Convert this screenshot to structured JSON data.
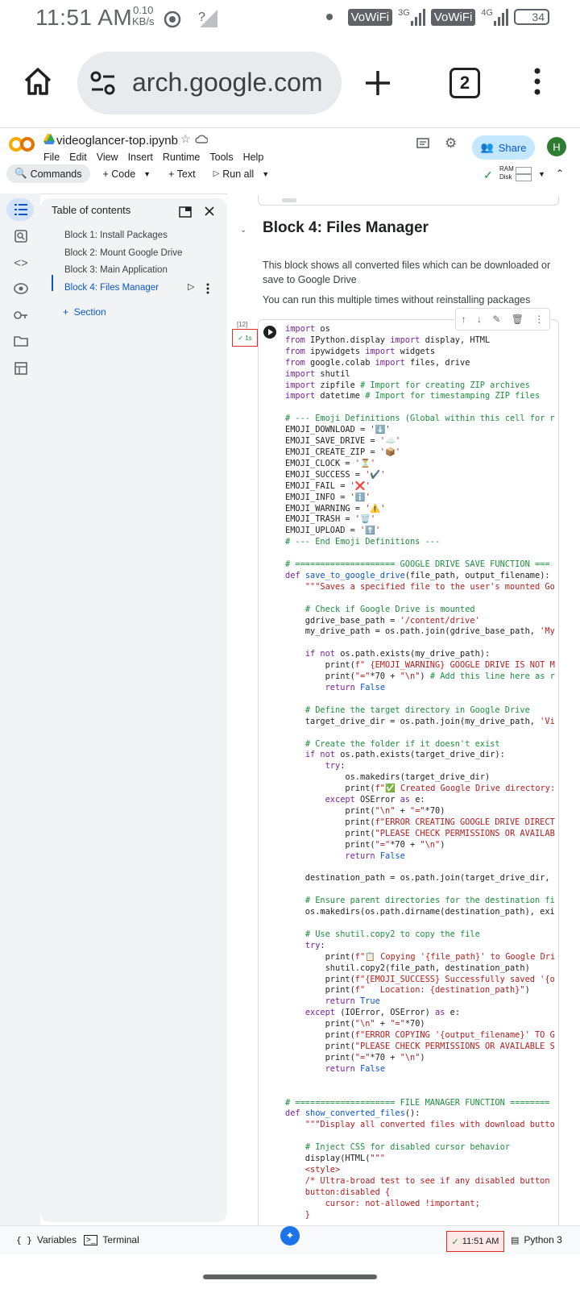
{
  "status": {
    "time": "11:51 AM",
    "speed_value": "0.10",
    "speed_unit": "KB/s",
    "wifi1": "VoWiFi",
    "net1": "3G",
    "wifi2": "VoWiFi",
    "net2": "4G",
    "battery": "34"
  },
  "browser": {
    "url": "arch.google.com",
    "tab_count": "2"
  },
  "colab": {
    "notebook_name": "videoglancer-top.ipynb",
    "menu": [
      "File",
      "Edit",
      "View",
      "Insert",
      "Runtime",
      "Tools",
      "Help"
    ],
    "share_label": "Share",
    "avatar_letter": "H",
    "toolbar": {
      "commands": "Commands",
      "code": "+ Code",
      "text": "+ Text",
      "run_all": "Run all",
      "ram": "RAM",
      "disk": "Disk"
    }
  },
  "toc": {
    "title": "Table of contents",
    "items": [
      "Block 1: Install Packages",
      "Block 2: Mount Google Drive",
      "Block 3: Main Application",
      "Block 4: Files Manager"
    ],
    "add_section": "Section"
  },
  "main": {
    "heading": "Block 4: Files Manager",
    "para1_line1": "This block shows all converted files which can be downloaded or",
    "para1_line2": "save to Google Drive",
    "para2": "You can run this multiple times without reinstalling packages",
    "exec_count": "[12]",
    "exec_time": "1s"
  },
  "bottom": {
    "variables": "Variables",
    "terminal": "Terminal",
    "time": "11:51 AM",
    "runtime": "Python 3"
  }
}
